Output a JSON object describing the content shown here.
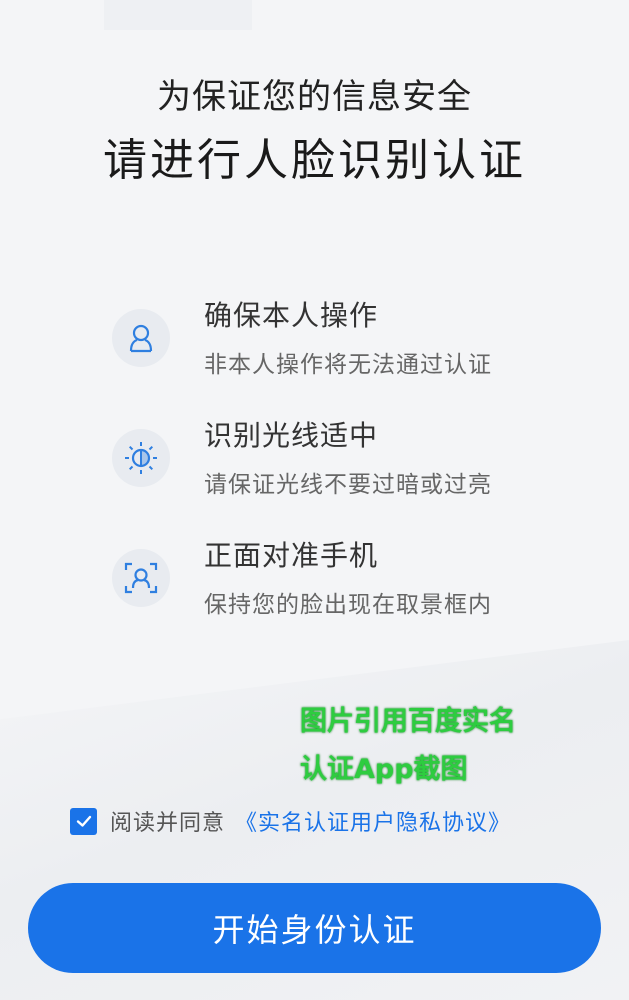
{
  "header": {
    "line1": "为保证您的信息安全",
    "line2": "请进行人脸识别认证"
  },
  "tips": [
    {
      "icon": "person-icon",
      "title": "确保本人操作",
      "desc": "非本人操作将无法通过认证"
    },
    {
      "icon": "light-icon",
      "title": "识别光线适中",
      "desc": "请保证光线不要过暗或过亮"
    },
    {
      "icon": "face-scan-icon",
      "title": "正面对准手机",
      "desc": "保持您的脸出现在取景框内"
    }
  ],
  "watermark": {
    "line1": "图片引用百度实名",
    "line2": "认证App截图"
  },
  "agreement": {
    "checked": true,
    "text": "阅读并同意",
    "link": "《实名认证用户隐私协议》"
  },
  "start_button": {
    "label": "开始身份认证"
  },
  "colors": {
    "accent": "#1a73e8",
    "background": "#f4f5f7",
    "watermark": "#2ecc40"
  }
}
